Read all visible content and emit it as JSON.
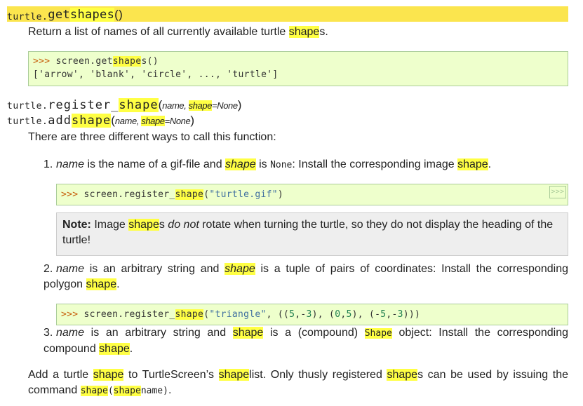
{
  "sig_getshapes": {
    "prefix": "turtle.",
    "name_a": "get",
    "name_b": "shapes",
    "parens": "()"
  },
  "desc_getshapes": {
    "a": "Return a list of names of all currently available turtle ",
    "b": "shape",
    "c": "s."
  },
  "code1": {
    "prompt": ">>> ",
    "l1a": "screen.get",
    "l1b": "shape",
    "l1c": "s()",
    "l2": "['arrow', 'blank', 'circle', ..., 'turtle']"
  },
  "sig_register": {
    "prefix": "turtle.",
    "name_a": "register_",
    "name_b": "shape",
    "open": "(",
    "arg1": "name, ",
    "arg2": "shape",
    "arg3": "=None",
    ")": ")",
    "close": ")"
  },
  "sig_add": {
    "prefix": "turtle.",
    "name_a": "add",
    "name_b": "shape",
    "open": "(",
    "arg1": "name, ",
    "arg2": "shape",
    "arg3": "=None",
    "close": ")"
  },
  "intro": "There are three different ways to call this function:",
  "item1": {
    "marker": "1.",
    "a": "name",
    "b": " is the name of a gif-file and ",
    "c": "shape",
    "d": " is ",
    "e": "None",
    "f": ": Install the corresponding image ",
    "g": "shape",
    "h": "."
  },
  "code2": {
    "prompt": ">>> ",
    "a": "screen.register_",
    "b": "shape",
    "c": "(",
    "d": "\"turtle.gif\"",
    "e": ")",
    "toggle": ">>>"
  },
  "note": {
    "label": "Note:",
    "a": " Image ",
    "b": "shape",
    "c": "s ",
    "d": "do not",
    "e": " rotate when turning the turtle, so they do not display the heading of the turtle!"
  },
  "item2": {
    "marker": "2.",
    "a": "name",
    "b": " is an arbitrary string and ",
    "c": "shape",
    "d": " is a tuple of pairs of coordinates: Install the corresponding polygon ",
    "e": "shape",
    "f": "."
  },
  "code3": {
    "prompt": ">>> ",
    "a": "screen.register_",
    "b": "shape",
    "c": "(",
    "d": "\"triangle\"",
    "e": ", ((",
    "f": "5",
    "g": ",-",
    "h": "3",
    "i": "), (",
    "j": "0",
    "k": ",",
    "l": "5",
    "m": "), (-",
    "n": "5",
    "o": ",-",
    "p": "3",
    "q": ")))"
  },
  "item3": {
    "marker": "3.",
    "a": "name",
    "b": " is an arbitrary string and ",
    "c": "shape",
    "d": " is a (compound) ",
    "e": "Shape",
    "f": " object: Install the corresponding compound ",
    "g": "shape",
    "h": "."
  },
  "final": {
    "a": "Add a turtle ",
    "b": "shape",
    "c": " to TurtleScreen’s ",
    "d": "shape",
    "e": "list. Only thusly registered ",
    "f": "shape",
    "g": "s can be used by issuing the command ",
    "h": "shape",
    "i": "(",
    "j": "shape",
    "k": "name",
    ")": ")",
    "l": ")",
    "m": "."
  }
}
